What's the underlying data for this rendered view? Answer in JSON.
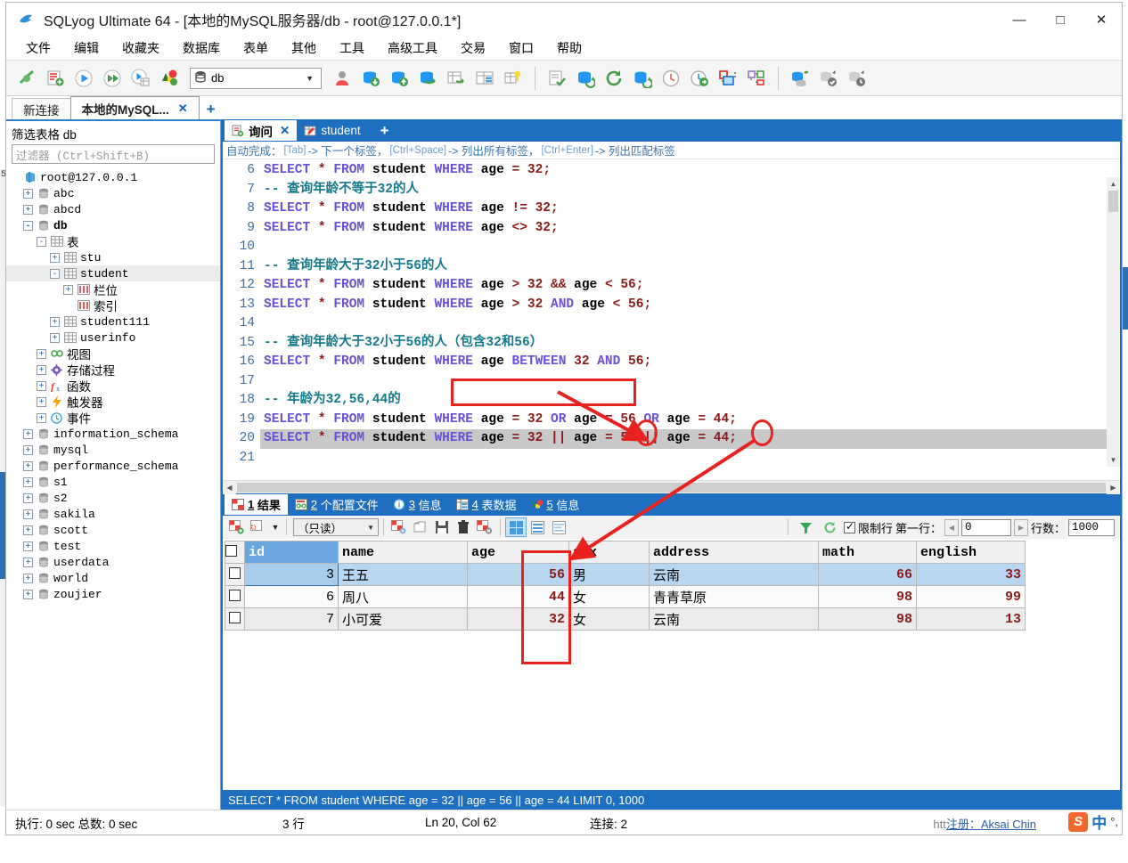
{
  "window": {
    "title": "SQLyog Ultimate 64 - [本地的MySQL服务器/db - root@127.0.0.1*]",
    "minimize": "—",
    "maximize": "□",
    "close": "✕"
  },
  "menu": [
    "文件",
    "编辑",
    "收藏夹",
    "数据库",
    "表单",
    "其他",
    "工具",
    "高级工具",
    "交易",
    "窗口",
    "帮助"
  ],
  "toolbar": {
    "db_selected": "db",
    "icons": [
      "new-connection-icon",
      "new-query-icon",
      "execute-query-icon",
      "execute-all-icon",
      "execute-explain-icon",
      "refresh-objects-icon",
      "user-manager-icon",
      "backup-database-icon",
      "restore-database-icon",
      "copy-database-icon",
      "import-external-data-icon",
      "table-data-export-icon",
      "schema-sync-icon",
      "query-builder-icon",
      "db-sync-icon",
      "refresh-icon",
      "refresh-db-icon",
      "history-icon",
      "scheduled-backup-icon",
      "tile-windows-icon",
      "cascade-windows-icon",
      "flush-icon",
      "check-db-icon",
      "restore-point-icon"
    ]
  },
  "connection_tabs": [
    {
      "label": "新连接",
      "active": false,
      "closable": false
    },
    {
      "label": "本地的MySQL...",
      "active": true,
      "closable": true,
      "close": "✕"
    }
  ],
  "connection_tab_add": "+",
  "sidebar": {
    "filter_title": "筛选表格 db",
    "filter_placeholder": "过滤器 (Ctrl+Shift+B)",
    "tree": [
      {
        "label": "root@127.0.0.1",
        "depth": 0,
        "expander": "none",
        "icon": "server-icon",
        "bold": false,
        "selected": false
      },
      {
        "label": "abc",
        "depth": 1,
        "expander": "+",
        "icon": "database-icon",
        "bold": false,
        "selected": false
      },
      {
        "label": "abcd",
        "depth": 1,
        "expander": "+",
        "icon": "database-icon",
        "bold": false,
        "selected": false
      },
      {
        "label": "db",
        "depth": 1,
        "expander": "-",
        "icon": "database-icon",
        "bold": true,
        "selected": false
      },
      {
        "label": "表",
        "depth": 2,
        "expander": "-",
        "icon": "tables-folder-icon",
        "bold": false,
        "selected": false,
        "cjk": true
      },
      {
        "label": "stu",
        "depth": 3,
        "expander": "+",
        "icon": "table-icon",
        "bold": false,
        "selected": false
      },
      {
        "label": "student",
        "depth": 3,
        "expander": "-",
        "icon": "table-icon",
        "bold": false,
        "selected": true
      },
      {
        "label": "栏位",
        "depth": 4,
        "expander": "+",
        "icon": "columns-icon",
        "bold": false,
        "selected": false,
        "cjk": true
      },
      {
        "label": "索引",
        "depth": 4,
        "expander": "none",
        "icon": "index-icon",
        "bold": false,
        "selected": false,
        "cjk": true
      },
      {
        "label": "student111",
        "depth": 3,
        "expander": "+",
        "icon": "table-icon",
        "bold": false,
        "selected": false
      },
      {
        "label": "userinfo",
        "depth": 3,
        "expander": "+",
        "icon": "table-icon",
        "bold": false,
        "selected": false
      },
      {
        "label": "视图",
        "depth": 2,
        "expander": "+",
        "icon": "views-icon",
        "bold": false,
        "selected": false,
        "cjk": true
      },
      {
        "label": "存储过程",
        "depth": 2,
        "expander": "+",
        "icon": "procedures-icon",
        "bold": false,
        "selected": false,
        "cjk": true
      },
      {
        "label": "函数",
        "depth": 2,
        "expander": "+",
        "icon": "functions-icon",
        "bold": false,
        "selected": false,
        "cjk": true
      },
      {
        "label": "触发器",
        "depth": 2,
        "expander": "+",
        "icon": "triggers-icon",
        "bold": false,
        "selected": false,
        "cjk": true
      },
      {
        "label": "事件",
        "depth": 2,
        "expander": "+",
        "icon": "events-icon",
        "bold": false,
        "selected": false,
        "cjk": true
      },
      {
        "label": "information_schema",
        "depth": 1,
        "expander": "+",
        "icon": "database-icon",
        "bold": false,
        "selected": false
      },
      {
        "label": "mysql",
        "depth": 1,
        "expander": "+",
        "icon": "database-icon",
        "bold": false,
        "selected": false
      },
      {
        "label": "performance_schema",
        "depth": 1,
        "expander": "+",
        "icon": "database-icon",
        "bold": false,
        "selected": false
      },
      {
        "label": "s1",
        "depth": 1,
        "expander": "+",
        "icon": "database-icon",
        "bold": false,
        "selected": false
      },
      {
        "label": "s2",
        "depth": 1,
        "expander": "+",
        "icon": "database-icon",
        "bold": false,
        "selected": false
      },
      {
        "label": "sakila",
        "depth": 1,
        "expander": "+",
        "icon": "database-icon",
        "bold": false,
        "selected": false
      },
      {
        "label": "scott",
        "depth": 1,
        "expander": "+",
        "icon": "database-icon",
        "bold": false,
        "selected": false
      },
      {
        "label": "test",
        "depth": 1,
        "expander": "+",
        "icon": "database-icon",
        "bold": false,
        "selected": false
      },
      {
        "label": "userdata",
        "depth": 1,
        "expander": "+",
        "icon": "database-icon",
        "bold": false,
        "selected": false
      },
      {
        "label": "world",
        "depth": 1,
        "expander": "+",
        "icon": "database-icon",
        "bold": false,
        "selected": false
      },
      {
        "label": "zoujier",
        "depth": 1,
        "expander": "+",
        "icon": "database-icon",
        "bold": false,
        "selected": false
      }
    ]
  },
  "query_tabs": [
    {
      "label": "询问",
      "active": true,
      "icon": "query-icon",
      "close": "✕"
    },
    {
      "label": "student",
      "active": false,
      "icon": "table-edit-icon"
    }
  ],
  "query_tab_add": "+",
  "editor": {
    "autocomplete_hint": {
      "prefix": "自动完成：",
      "parts": [
        {
          "key": "[Tab]",
          "text": "-> 下一个标签，"
        },
        {
          "key": "[Ctrl+Space]",
          "text": "-> 列出所有标签，"
        },
        {
          "key": "[Ctrl+Enter]",
          "text": "-> 列出匹配标签"
        }
      ]
    },
    "first_line_number": 6,
    "lines": [
      {
        "n": 6,
        "text": "SELECT * FROM student WHERE age = 32;",
        "highlight": false
      },
      {
        "n": 7,
        "text": "-- 查询年龄不等于32的人",
        "highlight": false
      },
      {
        "n": 8,
        "text": "SELECT * FROM student WHERE age != 32;",
        "highlight": false
      },
      {
        "n": 9,
        "text": "SELECT * FROM student WHERE age <> 32;",
        "highlight": false
      },
      {
        "n": 10,
        "text": "",
        "highlight": false
      },
      {
        "n": 11,
        "text": "-- 查询年龄大于32小于56的人",
        "highlight": false
      },
      {
        "n": 12,
        "text": "SELECT * FROM student WHERE age > 32 && age < 56;",
        "highlight": false
      },
      {
        "n": 13,
        "text": "SELECT * FROM student WHERE age > 32 AND age < 56;",
        "highlight": false
      },
      {
        "n": 14,
        "text": "",
        "highlight": false
      },
      {
        "n": 15,
        "text": "-- 查询年龄大于32小于56的人（包含32和56）",
        "highlight": false
      },
      {
        "n": 16,
        "text": "SELECT * FROM student WHERE age BETWEEN 32 AND 56;",
        "highlight": false
      },
      {
        "n": 17,
        "text": "",
        "highlight": false
      },
      {
        "n": 18,
        "text": "-- 年龄为32,56,44的",
        "highlight": false
      },
      {
        "n": 19,
        "text": "SELECT * FROM student WHERE age = 32 OR age = 56 OR age = 44;",
        "highlight": false
      },
      {
        "n": 20,
        "text": "SELECT * FROM student WHERE age = 32 || age = 56 || age = 44;",
        "highlight": true
      },
      {
        "n": 21,
        "text": "",
        "highlight": false
      }
    ]
  },
  "result_tabs": [
    {
      "num": "1",
      "label": "结果",
      "active": true,
      "icon": "result-grid-icon"
    },
    {
      "num": "2",
      "label": "个配置文件",
      "active": false,
      "icon": "profile-icon"
    },
    {
      "num": "3",
      "label": "信息",
      "active": false,
      "icon": "info-icon"
    },
    {
      "num": "4",
      "label": "表数据",
      "active": false,
      "icon": "table-data-icon"
    },
    {
      "num": "5",
      "label": "信息",
      "active": false,
      "icon": "messages-icon"
    }
  ],
  "result_toolbar": {
    "readonly_label": "（只读）",
    "limit_label": "限制行",
    "first_row_label": "第一行：",
    "first_row_value": "0",
    "rows_label": "行数：",
    "rows_value": "1000",
    "icons": [
      "add-row-icon",
      "edit-blob-icon",
      "dropdown-caret-icon",
      "duplicate-row-icon",
      "copy-row-icon",
      "save-icon",
      "delete-row-icon",
      "cancel-edit-icon",
      "grid-view-icon",
      "form-view-icon",
      "text-view-icon",
      "filter-icon",
      "refresh-data-icon"
    ]
  },
  "grid": {
    "columns": [
      "id",
      "name",
      "age",
      "sex",
      "address",
      "math",
      "english"
    ],
    "selected_column": "id",
    "rows": [
      {
        "id": "3",
        "name": "王五",
        "age": "56",
        "sex": "男",
        "address": "云南",
        "math": "66",
        "english": "33"
      },
      {
        "id": "6",
        "name": "周八",
        "age": "44",
        "sex": "女",
        "address": "青青草原",
        "math": "98",
        "english": "99"
      },
      {
        "id": "7",
        "name": "小可爱",
        "age": "32",
        "sex": "女",
        "address": "云南",
        "math": "98",
        "english": "13"
      }
    ]
  },
  "query_status": "SELECT * FROM student WHERE age = 32 || age = 56 || age = 44 LIMIT 0, 1000",
  "statusbar": {
    "exec": "执行: 0 sec  总数: 0 sec",
    "rows": "3 行",
    "cursor": "Ln 20, Col 62",
    "connections": "连接: 2",
    "watermark_prefix": "htt",
    "watermark_link": "注册：",
    "watermark_text": "Aksai Chin",
    "ime_zh": "中"
  }
}
